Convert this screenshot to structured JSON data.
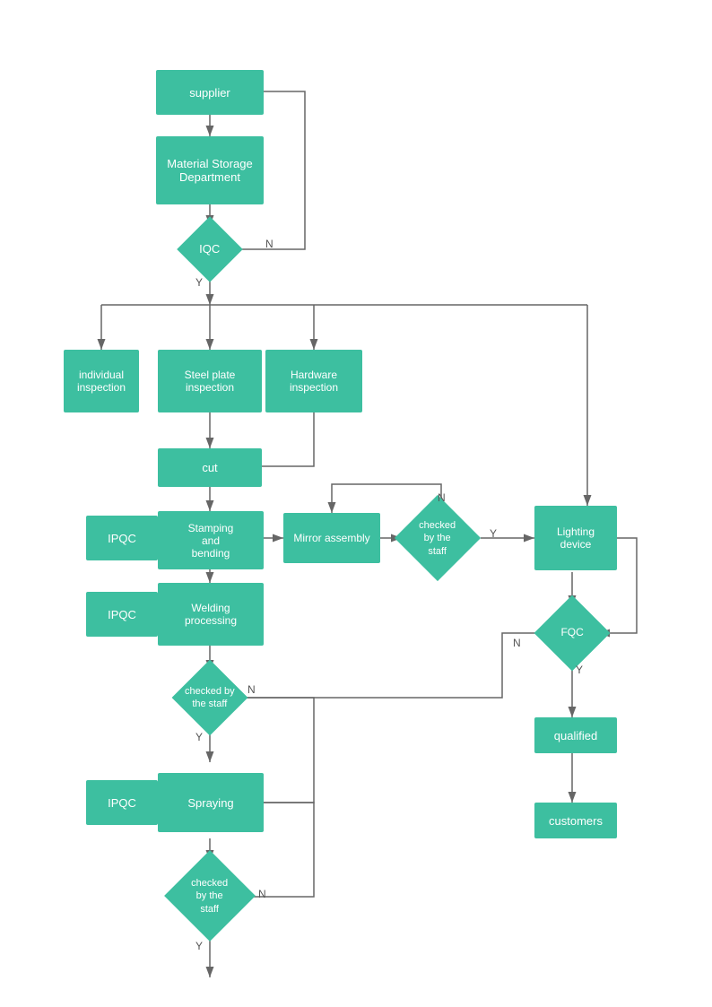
{
  "nodes": {
    "supplier": {
      "label": "supplier"
    },
    "material_storage": {
      "label": "Material Storage\nDepartment"
    },
    "iqc": {
      "label": "IQC"
    },
    "individual": {
      "label": "individual\ninspection"
    },
    "steel_plate": {
      "label": "Steel plate\ninspection"
    },
    "hardware": {
      "label": "Hardware\ninspection"
    },
    "cut": {
      "label": "cut"
    },
    "ipqc1": {
      "label": "IPQC"
    },
    "stamping": {
      "label": "Stamping\nand\nbending"
    },
    "mirror": {
      "label": "Mirror assembly"
    },
    "checked1": {
      "label": "checked\nby the\nstaff"
    },
    "lighting": {
      "label": "Lighting\ndevice"
    },
    "ipqc2": {
      "label": "IPQC"
    },
    "welding": {
      "label": "Welding\nprocessing"
    },
    "checked2": {
      "label": "checked by\nthe staff"
    },
    "fqc": {
      "label": "FQC"
    },
    "ipqc3": {
      "label": "IPQC"
    },
    "spraying": {
      "label": "Spraying"
    },
    "qualified": {
      "label": "qualified"
    },
    "checked3": {
      "label": "checked\nby the\nstaff"
    },
    "customers": {
      "label": "customers"
    }
  },
  "labels": {
    "n": "N",
    "y": "Y"
  }
}
